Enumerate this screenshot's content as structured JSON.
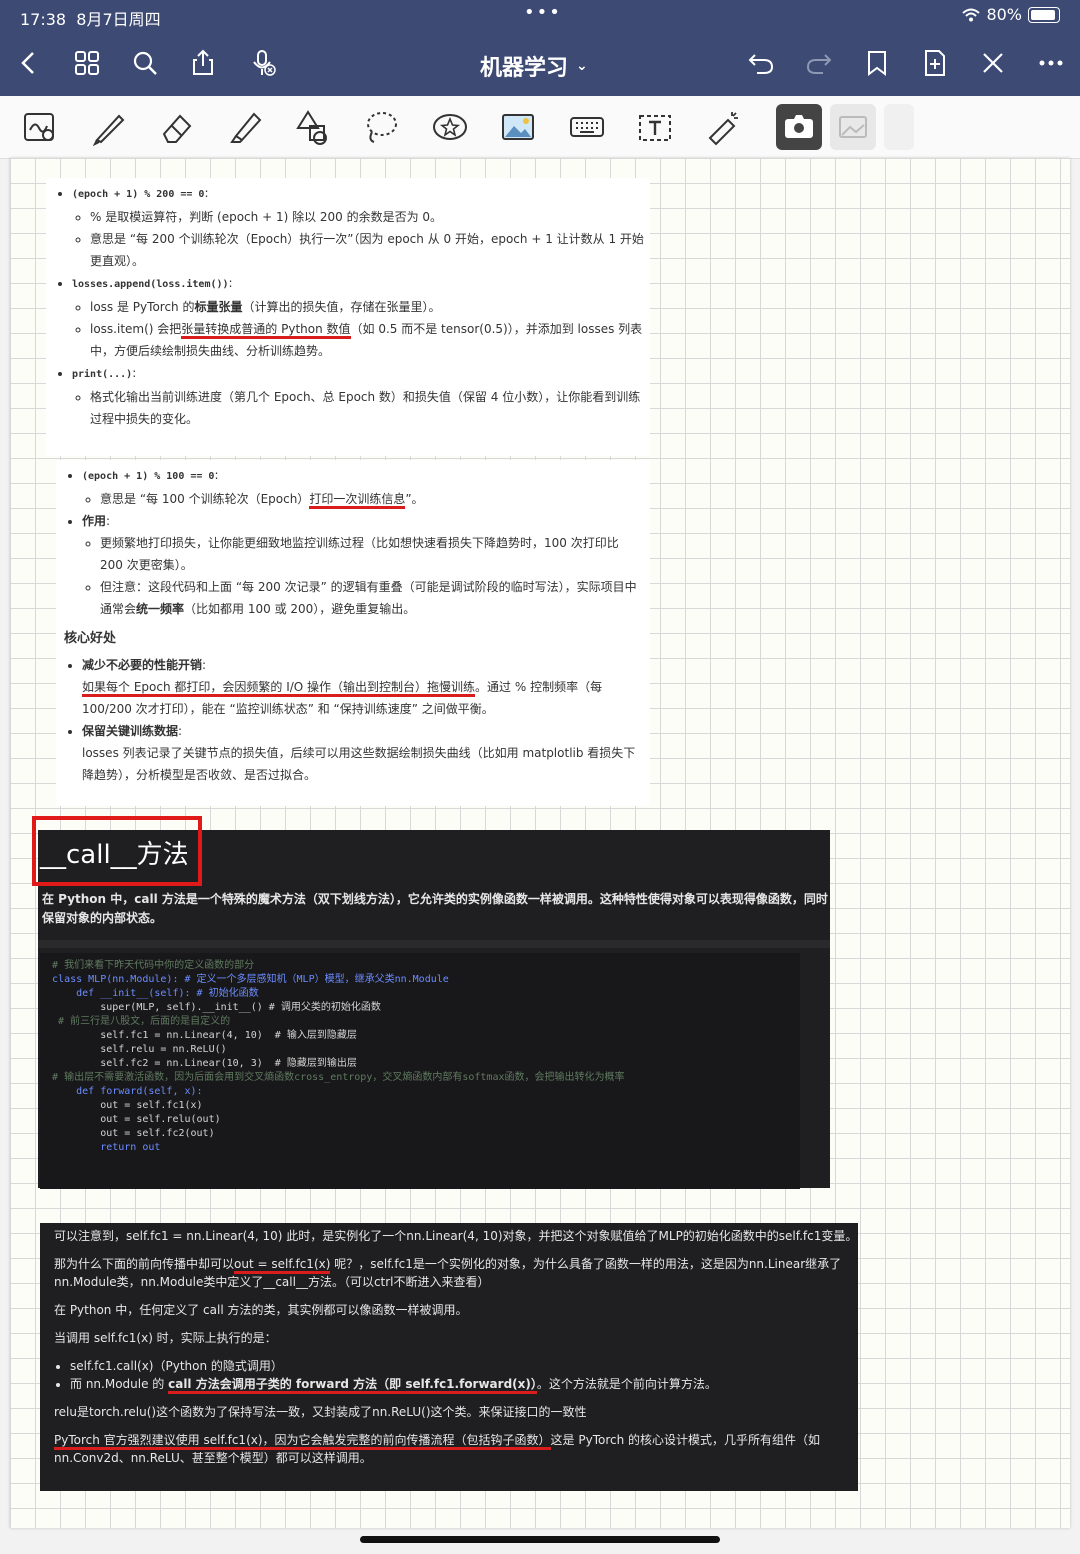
{
  "status": {
    "time": "17:38",
    "date": "8月7日周四",
    "battery": "80%"
  },
  "nav": {
    "title": "机器学习"
  },
  "notes": {
    "card1": {
      "b1_code": "(epoch + 1) % 200 == 0",
      "b1_s1": "% 是取模运算符，判断 (epoch + 1) 除以 200 的余数是否为 0。",
      "b1_s2": "意思是 “每 200 个训练轮次（Epoch）执行一次”（因为 epoch 从 0 开始，epoch + 1 让计数从 1 开始更直观）。",
      "b2_code": "losses.append(loss.item())",
      "b2_s1_pre": "loss 是 PyTorch 的",
      "b2_s1_bold": "标量张量",
      "b2_s1_post": "（计算出的损失值，存储在张量里）。",
      "b2_s2_pre": "loss.item() 会把",
      "b2_s2_ul": "张量转换成普通的 Python 数值",
      "b2_s2_post": "（如 0.5 而不是 tensor(0.5)），并添加到 losses 列表中，方便后续绘制损失曲线、分析训练趋势。",
      "b3_code": "print(...)",
      "b3_s1": "格式化输出当前训练进度（第几个 Epoch、总 Epoch 数）和损失值（保留 4 位小数），让你能看到训练过程中损失的变化。"
    },
    "card2": {
      "b1_code": "(epoch + 1) % 100 == 0",
      "b1_s1_pre": "意思是 “每 100 个训练轮次（Epoch）",
      "b1_s1_ul": "打印一次训练信息",
      "b1_s1_post": "”。",
      "b2_label": "作用",
      "b2_s1": "更频繁地打印损失，让你能更细致地监控训练过程（比如想快速看损失下降趋势时，100 次打印比 200 次更密集）。",
      "b2_s2_pre": "但注意：这段代码和上面 “每 200 次记录” 的逻辑有重叠（可能是调试阶段的临时写法），实际项目中通常会",
      "b2_s2_bold": "统一频率",
      "b2_s2_post": "（比如都用 100 或 200），避免重复输出。",
      "heading": "核心好处",
      "p1_label": "减少不必要的性能开销",
      "p1_ul": "如果每个 Epoch 都打印，会因频繁的 I/O 操作（输出到控制台）拖慢训练",
      "p1_post": "。通过 % 控制频率（每 100/200 次才打印），能在 “监控训练状态” 和 “保持训练速度” 之间做平衡。",
      "p2_label": "保留关键训练数据",
      "p2_text": "losses 列表记录了关键节点的损失值，后续可以用这些数据绘制损失曲线（比如用 matplotlib 看损失下降趋势），分析模型是否收敛、是否过拟合。"
    },
    "call": {
      "title": "__call__方法",
      "intro_pre": "在 Python 中，",
      "intro_bold": "call",
      "intro_post": " 方法是一个特殊的魔术方法（双下划线方法），它允许类的实例像函数一样被调用。这种特性使得对象可以表现得像函数，同时保留对象的内部状态。"
    },
    "code_lines": [
      "  # 我们来看下昨天代码中你的定义函数的部分",
      "  class MLP(nn.Module): # 定义一个多层感知机（MLP）模型，继承父类nn.Module",
      "      def __init__(self): # 初始化函数",
      "          super(MLP, self).__init__() # 调用父类的初始化函数",
      "   # 前三行是八股文，后面的是自定义的",
      "",
      "          self.fc1 = nn.Linear(4, 10)  # 输入层到隐藏层",
      "          self.relu = nn.ReLU()",
      "          self.fc2 = nn.Linear(10, 3)  # 隐藏层到输出层",
      "  # 输出层不需要激活函数，因为后面会用到交叉熵函数cross_entropy，交叉熵函数内部有softmax函数，会把输出转化为概率",
      "",
      "      def forward(self, x):",
      "          out = self.fc1(x)",
      "          out = self.relu(out)",
      "          out = self.fc2(out)",
      "          return out"
    ],
    "dark2": {
      "p1": "可以注意到，self.fc1 = nn.Linear(4, 10) 此时，是实例化了一个nn.Linear(4, 10)对象，并把这个对象赋值给了MLP的初始化函数中的self.fc1变量。",
      "p2_pre": "那为什么下面的前向传播中却可以",
      "p2_ul": "out = self.fc1(x)",
      "p2_post": " 呢？，self.fc1是一个实例化的对象，为什么具备了函数一样的用法，这是因为nn.Linear继承了nn.Module类，nn.Module类中定义了__call__方法。（可以ctrl不断进入来查看）",
      "p3": "在 Python 中，任何定义了 call 方法的类，其实例都可以像函数一样被调用。",
      "p4": "当调用 self.fc1(x) 时，实际上执行的是：",
      "li1": "self.fc1.call(x)（Python 的隐式调用）",
      "li2_pre": "而 nn.Module 的 ",
      "li2_ul": "call 方法会调用子类的 forward 方法（即 self.fc1.forward(x)）",
      "li2_post": "。这个方法就是个前向计算方法。",
      "p5": "relu是torch.relu()这个函数为了保持写法一致，又封装成了nn.ReLU()这个类。来保证接口的一致性",
      "p6_ul": "PyTorch 官方强烈建议使用 self.fc1(x)，因为它会触发完整的前向传播流程（包括钩子函数）",
      "p6_post": "这是 PyTorch 的核心设计模式，几乎所有组件（如 nn.Conv2d、nn.ReLU、甚至整个模型）都可以这样调用。"
    }
  },
  "colors": {
    "nav_bg": "#3c4a74",
    "annotation_red": "#d91c1c"
  }
}
